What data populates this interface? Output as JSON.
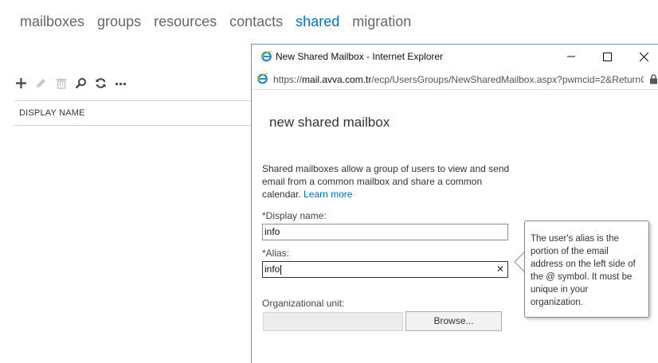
{
  "nav": {
    "items": [
      "mailboxes",
      "groups",
      "resources",
      "contacts",
      "shared",
      "migration"
    ],
    "active": "shared"
  },
  "toolbar": {
    "icons": [
      "add-icon",
      "edit-icon",
      "delete-icon",
      "search-icon",
      "refresh-icon",
      "more-icon"
    ]
  },
  "list": {
    "column_header": "DISPLAY NAME"
  },
  "browser": {
    "title": "New Shared Mailbox - Internet Explorer",
    "url_scheme": "https://",
    "url_host": "mail.avva.com.tr",
    "url_path": "/ecp/UsersGroups/NewSharedMailbox.aspx?pwmcid=2&ReturnO"
  },
  "form": {
    "heading": "new shared mailbox",
    "description": "Shared mailboxes allow a group of users to view and send email from a common mailbox and share a common calendar.",
    "learn_more": "Learn more",
    "display_name_label": "*Display name:",
    "display_name_value": "info",
    "alias_label": "*Alias:",
    "alias_value": "info",
    "ou_label": "Organizational unit:",
    "browse_label": "Browse..."
  },
  "tooltip": {
    "text": "The user's alias is the portion of the email address on the left side of the @ symbol. It must be unique in your organization."
  },
  "colors": {
    "accent": "#0072c6",
    "window_border": "#4b9fd5",
    "ie_icon": "#1e90d6"
  }
}
